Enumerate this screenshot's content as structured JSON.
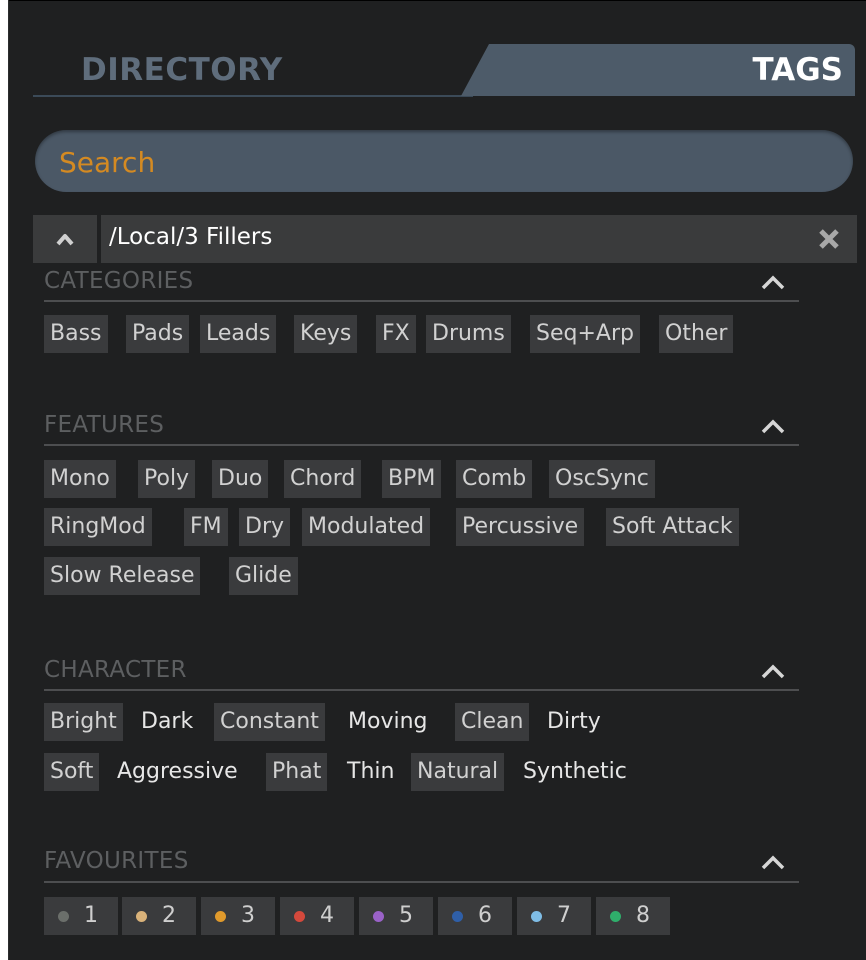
{
  "tabs": {
    "directory": "DIRECTORY",
    "tags": "TAGS"
  },
  "search": {
    "placeholder": "Search"
  },
  "path": {
    "text": "/Local/3 Fillers"
  },
  "categories": {
    "title": "CATEGORIES",
    "tags": [
      "Bass",
      "Pads",
      "Leads",
      "Keys",
      "FX",
      "Drums",
      "Seq+Arp",
      "Other"
    ]
  },
  "features": {
    "title": "FEATURES",
    "tags": [
      "Mono",
      "Poly",
      "Duo",
      "Chord",
      "BPM",
      "Comb",
      "OscSync",
      "RingMod",
      "FM",
      "Dry",
      "Modulated",
      "Percussive",
      "Soft Attack",
      "Slow Release",
      "Glide"
    ]
  },
  "character": {
    "title": "CHARACTER",
    "tags": [
      "Bright",
      "Dark",
      "Constant",
      "Moving",
      "Clean",
      "Dirty",
      "Soft",
      "Aggressive",
      "Phat",
      "Thin",
      "Natural",
      "Synthetic"
    ]
  },
  "favourites": {
    "title": "FAVOURITES",
    "items": [
      {
        "label": "1",
        "color": "#6b6f6b"
      },
      {
        "label": "2",
        "color": "#d9b27a"
      },
      {
        "label": "3",
        "color": "#e09a2c"
      },
      {
        "label": "4",
        "color": "#d4493c"
      },
      {
        "label": "5",
        "color": "#9a62c8"
      },
      {
        "label": "6",
        "color": "#2f5fa8"
      },
      {
        "label": "7",
        "color": "#7fbde6"
      },
      {
        "label": "8",
        "color": "#2fae6b"
      }
    ]
  },
  "colors": {
    "panel_bg": "#1f2021",
    "tag_bg": "#3a3b3d",
    "tab_active": "#4d5b69",
    "search_text": "#d48a22",
    "section_title": "#5d5f61"
  }
}
